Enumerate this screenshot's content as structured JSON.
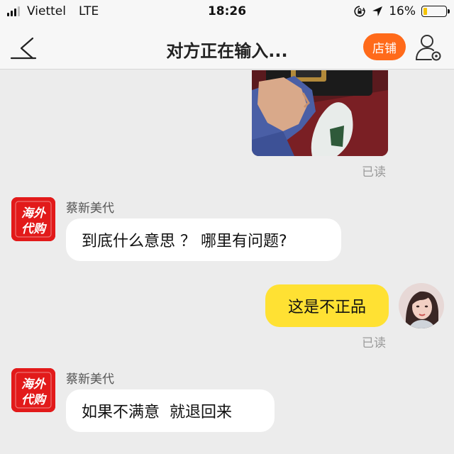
{
  "status_bar": {
    "carrier": "Viettel",
    "network": "LTE",
    "time": "18:26",
    "battery_percent": "16%",
    "battery_level": 0.16,
    "icons": [
      "signal-bars-icon",
      "rotation-lock-icon",
      "location-arrow-icon",
      "battery-icon"
    ]
  },
  "nav": {
    "title": "对方正在输入...",
    "shop_label": "店铺",
    "back_icon": "chevron-left-icon",
    "profile_icon": "user-settings-icon"
  },
  "colors": {
    "accent_orange": "#ff6a1a",
    "bubble_yellow": "#ffe133",
    "chat_background": "#ececec",
    "shop_avatar_red": "#e21a1a"
  },
  "messages": [
    {
      "type": "image",
      "side": "right",
      "status": "已读"
    },
    {
      "type": "text",
      "side": "left",
      "sender": "蔡新美代",
      "avatar_text": "海外代购",
      "text": "到底什么意思 ？ 哪里有问题?"
    },
    {
      "type": "text",
      "side": "right",
      "text": "这是不正品",
      "status": "已读"
    },
    {
      "type": "text",
      "side": "left",
      "sender": "蔡新美代",
      "avatar_text": "海外代购",
      "text": "如果不满意  就退回来"
    }
  ]
}
